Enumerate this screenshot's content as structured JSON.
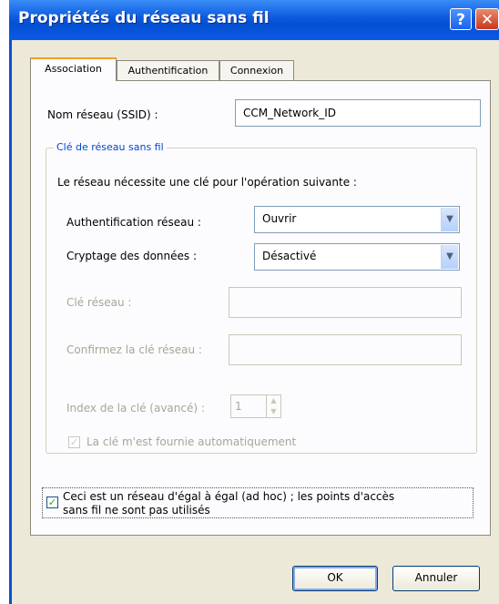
{
  "window": {
    "title": "Propriétés du réseau sans fil",
    "help_glyph": "?",
    "close_glyph": "✕"
  },
  "tabs": [
    {
      "label": "Association",
      "active": true
    },
    {
      "label": "Authentification",
      "active": false
    },
    {
      "label": "Connexion",
      "active": false
    }
  ],
  "ssid": {
    "label": "Nom réseau (SSID) :",
    "value": "CCM_Network_ID"
  },
  "wireless_key_group": {
    "title": "Clé de réseau sans fil",
    "description": "Le réseau nécessite une clé pour l'opération suivante :",
    "auth": {
      "label": "Authentification réseau :",
      "value": "Ouvrir"
    },
    "encryption": {
      "label": "Cryptage des données :",
      "value": "Désactivé"
    },
    "network_key": {
      "label": "Clé réseau :",
      "value": ""
    },
    "confirm_key": {
      "label": "Confirmez la clé réseau :",
      "value": ""
    },
    "key_index": {
      "label": "Index de la clé (avancé) :",
      "value": "1"
    },
    "auto_key": {
      "label": "La clé m'est fournie automatiquement",
      "checked": true
    }
  },
  "adhoc": {
    "line1": "Ceci est un réseau d'égal à égal (ad hoc) ; les points d'accès",
    "line2": "sans fil ne sont pas utilisés",
    "checked": true
  },
  "buttons": {
    "ok": "OK",
    "cancel": "Annuler"
  },
  "icons": {
    "dropdown": "chevron-down-icon",
    "check": "checkmark-icon"
  },
  "colors": {
    "titlebar": "#0a59e0",
    "group_title": "#0046d5",
    "check": "#21a121"
  }
}
